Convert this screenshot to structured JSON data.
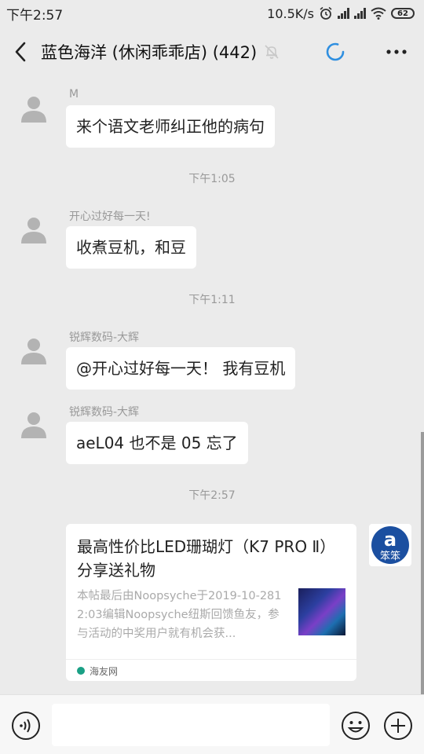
{
  "status": {
    "time": "下午2:57",
    "net_speed": "10.5K/s",
    "battery": "62"
  },
  "header": {
    "title": "蓝色海洋 (休闲乖乖店) (442)"
  },
  "messages": [
    {
      "sender": "M",
      "text": "来个语文老师纠正他的病句"
    },
    {
      "time": "下午1:05"
    },
    {
      "sender": "开心过好每一天!",
      "text": "收煮豆机，和豆"
    },
    {
      "time": "下午1:11"
    },
    {
      "sender": "锐辉数码-大辉",
      "text": "@开心过好每一天！ 我有豆机"
    },
    {
      "sender": "锐辉数码-大辉",
      "text": "aeL04 也不是 05 忘了"
    },
    {
      "time": "下午2:57"
    }
  ],
  "card": {
    "title": "最高性价比LED珊瑚灯（K7 PRO Ⅱ）分享送礼物",
    "desc": "本帖最后由Noopsyche于2019-10-2812:03编辑Noopsyche纽斯回馈鱼友，参与活动的中奖用户就有机会获...",
    "source": "海友网"
  },
  "right_avatar": {
    "text": "笨笨"
  },
  "colors": {
    "background": "#ebebeb",
    "bubble": "#ffffff",
    "accent_blue": "#2f8fe0"
  }
}
